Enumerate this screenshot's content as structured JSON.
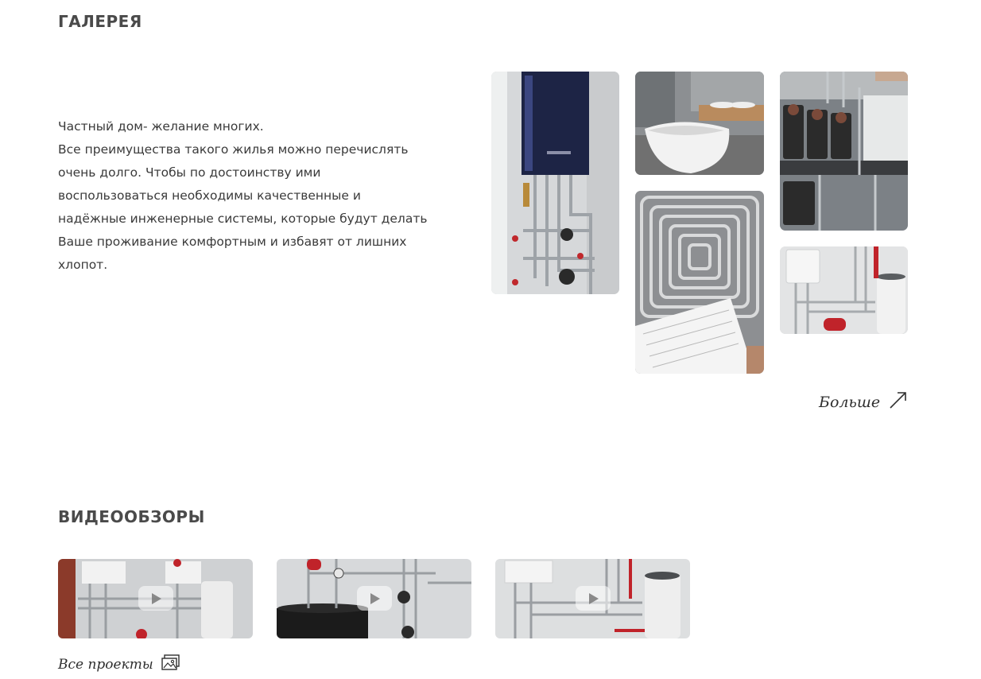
{
  "gallery": {
    "title": "ГАЛЕРЕЯ",
    "intro": [
      "Частный дом- желание многих.",
      "Все преимущества такого жилья можно перечислять очень долго. Чтобы по достоинству ими воспользоваться необходимы качественные и надёжные инженерные системы, которые будут делать Ваше проживание комфортным и избавят от лишних хлопот."
    ],
    "more_label": "Больше",
    "more_icon": "arrow-up-right-icon"
  },
  "videos": {
    "title": "ВИДЕООБЗОРЫ",
    "play_icon": "play-icon",
    "all_projects_label": "Все проекты",
    "all_projects_icon": "gallery-icon"
  }
}
